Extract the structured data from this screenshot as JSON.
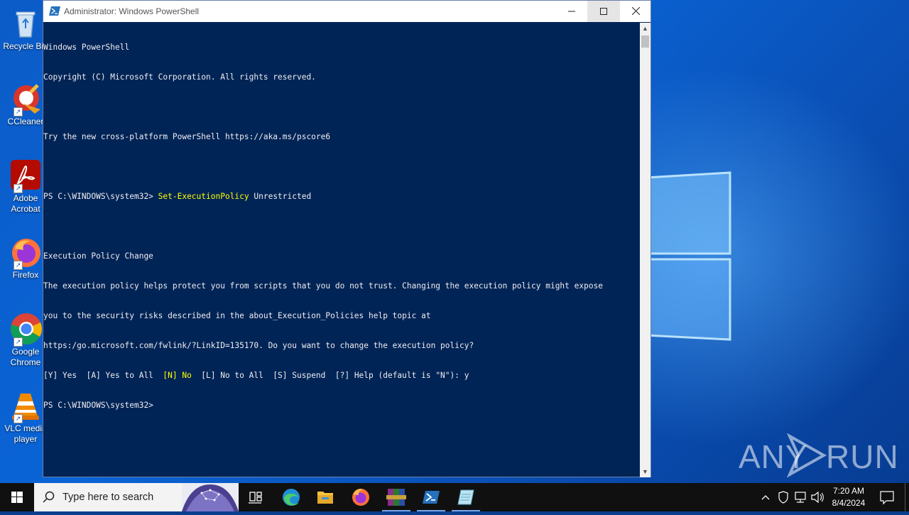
{
  "desktop": {
    "icons": [
      {
        "label": "Recycle Bin"
      },
      {
        "label": "CCleaner"
      },
      {
        "label": "Adobe Acrobat"
      },
      {
        "label": "Firefox"
      },
      {
        "label": "Google Chrome"
      },
      {
        "label": "VLC media player"
      }
    ],
    "watermark": {
      "left": "ANY",
      "right": "RUN"
    }
  },
  "window": {
    "title": "Administrator: Windows PowerShell",
    "icon": "powershell-icon",
    "controls": {
      "minimize": "—",
      "maximize": "☐",
      "close": "✕"
    }
  },
  "console": {
    "lines": [
      "Windows PowerShell",
      "Copyright (C) Microsoft Corporation. All rights reserved.",
      "",
      "Try the new cross-platform PowerShell https://aka.ms/pscore6",
      "",
      "",
      "",
      "Execution Policy Change",
      "The execution policy helps protect you from scripts that you do not trust. Changing the execution policy might expose",
      "you to the security risks described in the about_Execution_Policies help topic at",
      "https:/go.microsoft.com/fwlink/?LinkID=135170. Do you want to change the execution policy?",
      "",
      "PS C:\\WINDOWS\\system32>"
    ],
    "prompt1": "PS C:\\WINDOWS\\system32> ",
    "command": "Set-ExecutionPolicy",
    "command_arg": " Unrestricted",
    "choices_before": "[Y] Yes  [A] Yes to All  ",
    "choices_default": "[N] No",
    "choices_after": "  [L] No to All  [S] Suspend  [?] Help (default is \"N\"): y",
    "text_color": "#eeedf0",
    "background": "#012456",
    "highlight": "#ffff00"
  },
  "taskbar": {
    "search_placeholder": "Type here to search",
    "apps": [
      "task-view-icon",
      "edge-icon",
      "file-explorer-icon",
      "firefox-icon",
      "winrar-icon",
      "powershell-icon",
      "notepad-icon"
    ],
    "time": "7:20 AM",
    "date": "8/4/2024"
  }
}
